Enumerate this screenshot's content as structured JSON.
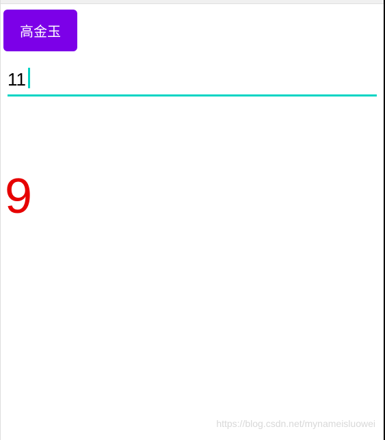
{
  "button": {
    "label": "高金玉"
  },
  "input": {
    "value": "11"
  },
  "display": {
    "number": "9"
  },
  "watermark": {
    "text": "https://blog.csdn.net/mynameisluowei"
  }
}
